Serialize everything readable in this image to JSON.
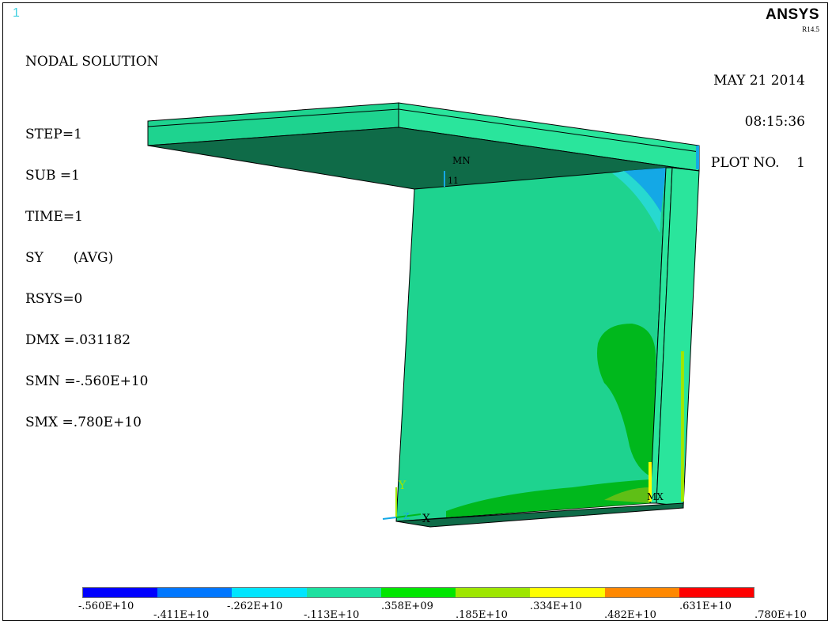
{
  "window_number": "1",
  "brand": "ANSYS",
  "version": "R14.5",
  "solution_title": "NODAL SOLUTION",
  "info_lines": [
    "STEP=1",
    "SUB =1",
    "TIME=1",
    "SY       (AVG)",
    "RSYS=0",
    "DMX =.031182",
    "SMN =-.560E+10",
    "SMX =.780E+10"
  ],
  "date": "MAY 21 2014",
  "time": "08:15:36",
  "plot_label": "PLOT NO.",
  "plot_number": "1",
  "markers": {
    "min": "MN",
    "max": "MX",
    "min_node": "11"
  },
  "triad": {
    "y": "Y",
    "x": "X",
    "z": "Z"
  },
  "colors": {
    "face_main": "#1ed38f",
    "face_dark": "#0f6b48",
    "face_band": "#2ae59c",
    "hotspot_green": "#00b81c",
    "hotspot_olive": "#5fbf16",
    "blue_corner": "#14a8e6",
    "cyan_corner": "#27d9d0"
  },
  "legend": {
    "colors": [
      "#0000ff",
      "#0077ff",
      "#00e5ff",
      "#1ee0a0",
      "#00e600",
      "#9ee600",
      "#ffff00",
      "#ff8800",
      "#ff0000"
    ],
    "labels_top": [
      ".560E+10",
      ".262E+10",
      ".358E+09",
      ".334E+10",
      ".631E+10"
    ],
    "labels_top_signs": [
      "-",
      "-",
      "",
      "",
      ""
    ],
    "labels_bottom": [
      "-.411E+10",
      "-.113E+10",
      ".185E+10",
      ".482E+10",
      ".780E+10"
    ]
  }
}
